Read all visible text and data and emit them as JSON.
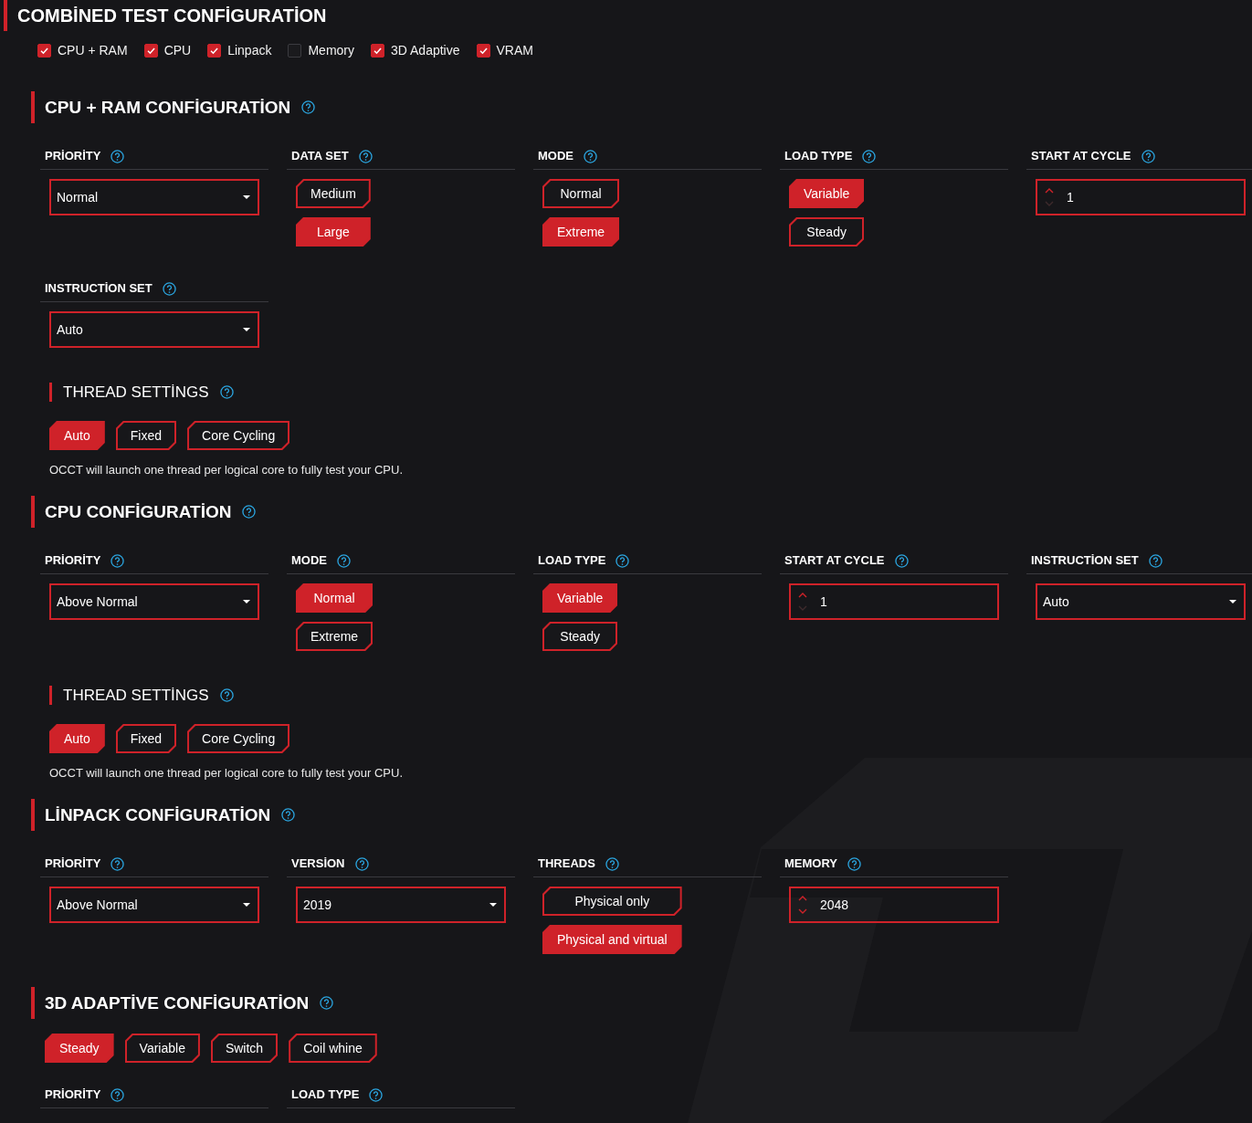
{
  "title": "COMBİNED TEST CONFİGURATİON",
  "tests": [
    {
      "label": "CPU + RAM",
      "checked": true
    },
    {
      "label": "CPU",
      "checked": true
    },
    {
      "label": "Linpack",
      "checked": true
    },
    {
      "label": "Memory",
      "checked": false
    },
    {
      "label": "3D Adaptive",
      "checked": true
    },
    {
      "label": "VRAM",
      "checked": true
    }
  ],
  "sections": [
    {
      "title": "CPU + RAM CONFİGURATİON",
      "rows": [
        [
          {
            "label": "PRİORİTY",
            "kind": "dropdown",
            "value": "Normal"
          },
          {
            "label": "DATA SET",
            "kind": "options",
            "options": [
              {
                "label": "Medium",
                "selected": false
              },
              {
                "label": "Large",
                "selected": true
              }
            ]
          },
          {
            "label": "MODE",
            "kind": "options",
            "options": [
              {
                "label": "Normal",
                "selected": false
              },
              {
                "label": "Extreme",
                "selected": true
              }
            ]
          },
          {
            "label": "LOAD TYPE",
            "kind": "options",
            "options": [
              {
                "label": "Variable",
                "selected": true
              },
              {
                "label": "Steady",
                "selected": false
              }
            ]
          },
          {
            "label": "START AT CYCLE",
            "kind": "spinner",
            "value": "1",
            "can_increase": true,
            "can_decrease": false
          }
        ],
        [
          {
            "label": "INSTRUCTİON SET",
            "kind": "dropdown",
            "value": "Auto"
          }
        ]
      ],
      "thread_settings": {
        "title": "THREAD SETTİNGS",
        "options": [
          {
            "label": "Auto",
            "selected": true
          },
          {
            "label": "Fixed",
            "selected": false
          },
          {
            "label": "Core Cycling",
            "selected": false
          }
        ],
        "description": "OCCT will launch one thread per logical core to fully test your CPU."
      }
    },
    {
      "title": "CPU CONFİGURATİON",
      "rows": [
        [
          {
            "label": "PRİORİTY",
            "kind": "dropdown",
            "value": "Above Normal"
          },
          {
            "label": "MODE",
            "kind": "options",
            "options": [
              {
                "label": "Normal",
                "selected": true
              },
              {
                "label": "Extreme",
                "selected": false
              }
            ]
          },
          {
            "label": "LOAD TYPE",
            "kind": "options",
            "options": [
              {
                "label": "Variable",
                "selected": true
              },
              {
                "label": "Steady",
                "selected": false
              }
            ]
          },
          {
            "label": "START AT CYCLE",
            "kind": "spinner",
            "value": "1",
            "can_increase": true,
            "can_decrease": false
          },
          {
            "label": "INSTRUCTİON SET",
            "kind": "dropdown",
            "value": "Auto"
          }
        ]
      ],
      "thread_settings": {
        "title": "THREAD SETTİNGS",
        "options": [
          {
            "label": "Auto",
            "selected": true
          },
          {
            "label": "Fixed",
            "selected": false
          },
          {
            "label": "Core Cycling",
            "selected": false
          }
        ],
        "description": "OCCT will launch one thread per logical core to fully test your CPU."
      }
    },
    {
      "title": "LİNPACK CONFİGURATİON",
      "rows": [
        [
          {
            "label": "PRİORİTY",
            "kind": "dropdown",
            "value": "Above Normal"
          },
          {
            "label": "VERSİON",
            "kind": "dropdown",
            "value": "2019"
          },
          {
            "label": "THREADS",
            "kind": "options",
            "options": [
              {
                "label": "Physical only",
                "selected": false
              },
              {
                "label": "Physical and virtual",
                "selected": true
              }
            ]
          },
          {
            "label": "MEMORY",
            "kind": "spinner",
            "value": "2048",
            "can_increase": true,
            "can_decrease": true
          }
        ]
      ]
    },
    {
      "title": "3D ADAPTİVE CONFİGURATİON",
      "modes": [
        {
          "label": "Steady",
          "selected": true
        },
        {
          "label": "Variable",
          "selected": false
        },
        {
          "label": "Switch",
          "selected": false
        },
        {
          "label": "Coil whine",
          "selected": false
        }
      ],
      "rows": [
        [
          {
            "label": "PRİORİTY",
            "kind": "label"
          },
          {
            "label": "LOAD TYPE",
            "kind": "label"
          }
        ]
      ]
    }
  ]
}
